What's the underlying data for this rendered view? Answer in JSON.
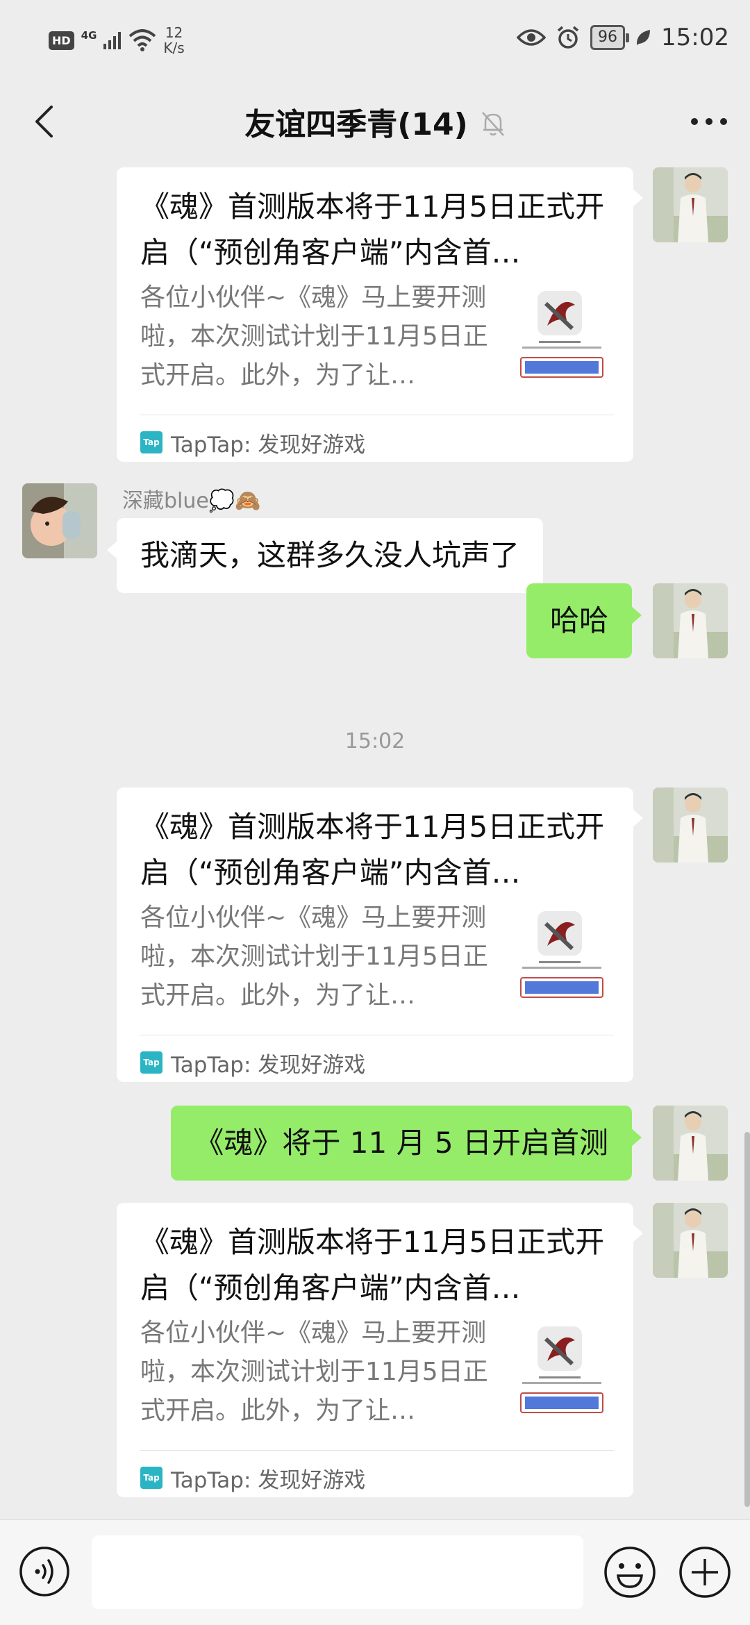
{
  "status_bar": {
    "hd": "HD",
    "network": "4G",
    "speed_value": "12",
    "speed_unit": "K/s",
    "battery": "96",
    "time": "15:02"
  },
  "header": {
    "title": "友谊四季青(14)"
  },
  "messages": {
    "card1": {
      "title": "《魂》首测版本将于11月5日正式开启（“预创角客户端”内含首…",
      "desc": "各位小伙伴~《魂》马上要开测啦，本次测试计划于11月5日正式开启。此外，为了让…",
      "source": "TapTap: 发现好游戏"
    },
    "msg1": {
      "sender": "深藏blue💭🙈",
      "text": "我滴天，这群多久没人坑声了"
    },
    "msg2": {
      "text": "哈哈"
    },
    "time_separator": "15:02",
    "card2": {
      "title": "《魂》首测版本将于11月5日正式开启（“预创角客户端”内含首…",
      "desc": "各位小伙伴~《魂》马上要开测啦，本次测试计划于11月5日正式开启。此外，为了让…",
      "source": "TapTap: 发现好游戏"
    },
    "msg3": {
      "text": "《魂》将于 11 月 5 日开启首测"
    },
    "card3": {
      "title": "《魂》首测版本将于11月5日正式开启（“预创角客户端”内含首…",
      "desc": "各位小伙伴~《魂》马上要开测啦，本次测试计划于11月5日正式开启。此外，为了让…",
      "source": "TapTap: 发现好游戏"
    }
  },
  "icons": {
    "back": "back-arrow-icon",
    "mute": "bell-muted-icon",
    "more": "more-dots-icon",
    "voice": "voice-icon",
    "emoji": "emoji-icon",
    "plus": "plus-icon",
    "tap_logo": "Tap"
  },
  "colors": {
    "background": "#ededed",
    "outgoing_bubble": "#95ec69",
    "incoming_bubble": "#ffffff",
    "taptap_brand": "#2bb5c4"
  }
}
